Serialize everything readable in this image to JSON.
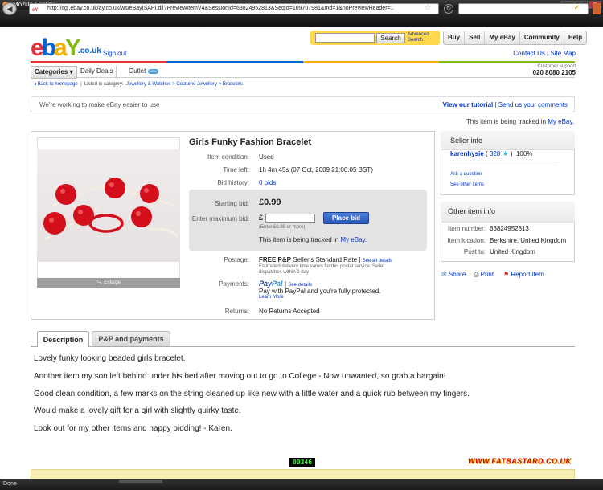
{
  "browser": {
    "title": "Mozilla Firefox",
    "url": "http://cgi.ebay.co.uk/ay.co.uk/ws/eBayISAPI.dll?PreviewItemV4&SessionId=63824952813&SeqId=109707981&md=1&noPreviewHeader=1",
    "status": "Done"
  },
  "header": {
    "logo_tld": ".co.uk",
    "sign_out": "Sign out",
    "search_button": "Search",
    "advanced_search_line1": "Advanced",
    "advanced_search_line2": "Search",
    "top_nav": [
      "Buy",
      "Sell",
      "My eBay",
      "Community",
      "Help"
    ],
    "contact_us": "Contact Us",
    "separator": "|",
    "site_map": "Site Map",
    "categories": "Categories",
    "daily_deals": "Daily Deals",
    "outlet": "Outlet",
    "new_badge": "NEW",
    "support_label": "Customer support",
    "support_number": "020 8080 2105",
    "colorbar": [
      "#e53238",
      "#0064d2",
      "#f5af02",
      "#86b817"
    ]
  },
  "breadcrumb": {
    "back": "Back to homepage",
    "listed": "Listed in category:",
    "path": "Jewellery & Watches > Costume Jewellery > Bracelets"
  },
  "notice": {
    "text": "We're working to make eBay easier to use",
    "tutorial": "View our tutorial",
    "separator": "|",
    "comments": "Send us your comments"
  },
  "tracking": {
    "prefix": "This item is being tracked in",
    "link": "My eBay."
  },
  "item": {
    "title": "Girls Funky Fashion Bracelet",
    "enlarge": "Enlarge",
    "condition_label": "Item condition:",
    "condition": "Used",
    "time_left_label": "Time left:",
    "time_left": "1h 4m 45s (07 Oct, 2009  21:00:05 BST)",
    "bid_history_label": "Bid history:",
    "bid_history": "0 bids",
    "starting_bid_label": "Starting bid:",
    "starting_bid": "£0.99",
    "max_bid_label": "Enter maximum bid:",
    "currency": "£",
    "min_hint": "(Enter £0.99 or more)",
    "place_bid": "Place bid",
    "postage_label": "Postage:",
    "postage_main": "FREE P&P",
    "postage_service": "Seller's Standard Rate",
    "postage_divider": "|",
    "see_all": "See all details",
    "postage_note1": "Estimated delivery time varies for this postal service. Seller",
    "postage_note2": "dispatches within 1 day",
    "payments_label": "Payments:",
    "paypal_pay": "Pay",
    "paypal_pal": "Pal",
    "payments_divider": "|",
    "see_details": "See details",
    "paypal_text": "Pay with PayPal and you're fully protected.",
    "learn_more": "Learn More",
    "returns_label": "Returns:",
    "returns": "No Returns Accepted"
  },
  "seller": {
    "title": "Seller info",
    "name": "karenhysie",
    "open_paren": "(",
    "feedback": "328",
    "close_paren": ")",
    "percent": "100%",
    "ask": "Ask a question",
    "other_items": "See other items"
  },
  "other_info": {
    "title": "Other item info",
    "number_label": "Item number:",
    "number": "63824952813",
    "location_label": "Item location:",
    "location": "Berkshire, United Kingdom",
    "post_label": "Post to:",
    "post": "United Kingdom"
  },
  "actions": {
    "share": "Share",
    "print": "Print",
    "report": "Report item"
  },
  "tabs": {
    "description": "Description",
    "pp": "P&P and payments"
  },
  "description": [
    "Lovely funky looking beaded girls bracelet.",
    "Another item my son left behind under his bed after moving out to go to College - Now unwanted, so grab a bargain!",
    "Good clean condition, a few marks on the string cleaned up like new with a little water and a quick rub between my fingers.",
    "Would make a lovely gift for a girl with slightly quirky taste.",
    "Look out for my other items and happy bidding! - Karen."
  ],
  "footer": {
    "counter": "00346",
    "site": "WWW.FATBASTARD.CO.UK"
  }
}
